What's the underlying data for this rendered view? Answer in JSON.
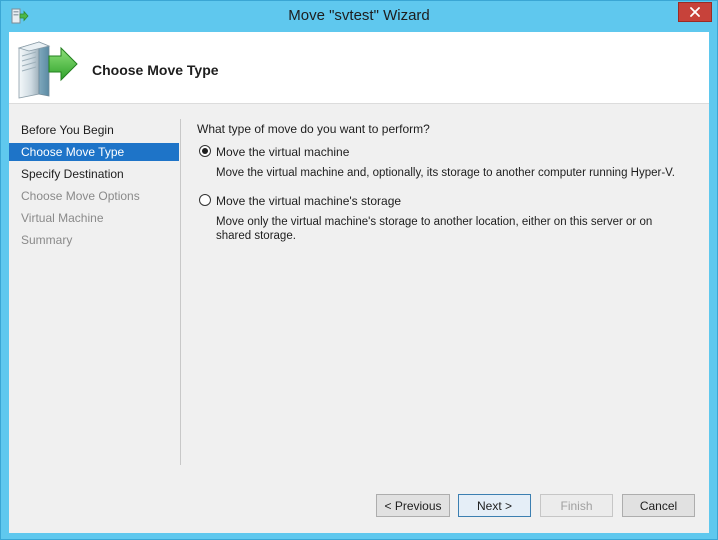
{
  "window": {
    "title": "Move \"svtest\" Wizard",
    "accent_color": "#5fc8ee",
    "close_color": "#c7423a"
  },
  "header": {
    "title": "Choose Move Type"
  },
  "sidebar": {
    "items": [
      {
        "label": "Before You Begin",
        "state": "normal"
      },
      {
        "label": "Choose Move Type",
        "state": "active"
      },
      {
        "label": "Specify Destination",
        "state": "normal"
      },
      {
        "label": "Choose Move Options",
        "state": "disabled"
      },
      {
        "label": "Virtual Machine",
        "state": "disabled"
      },
      {
        "label": "Summary",
        "state": "disabled"
      }
    ],
    "active_color": "#1e74c8"
  },
  "main": {
    "question": "What type of move do you want to perform?",
    "options": [
      {
        "label": "Move the virtual machine",
        "description": "Move the virtual machine and, optionally, its storage to another computer running Hyper-V.",
        "checked": true
      },
      {
        "label": "Move the virtual machine's storage",
        "description": "Move only the virtual machine's storage to another location, either on this server or on shared storage.",
        "checked": false
      }
    ]
  },
  "buttons": {
    "previous": "< Previous",
    "next": "Next >",
    "finish": "Finish",
    "cancel": "Cancel"
  },
  "icons": {
    "title": "wizard-move-icon",
    "header": "server-move-arrow-icon",
    "close": "close-icon"
  }
}
